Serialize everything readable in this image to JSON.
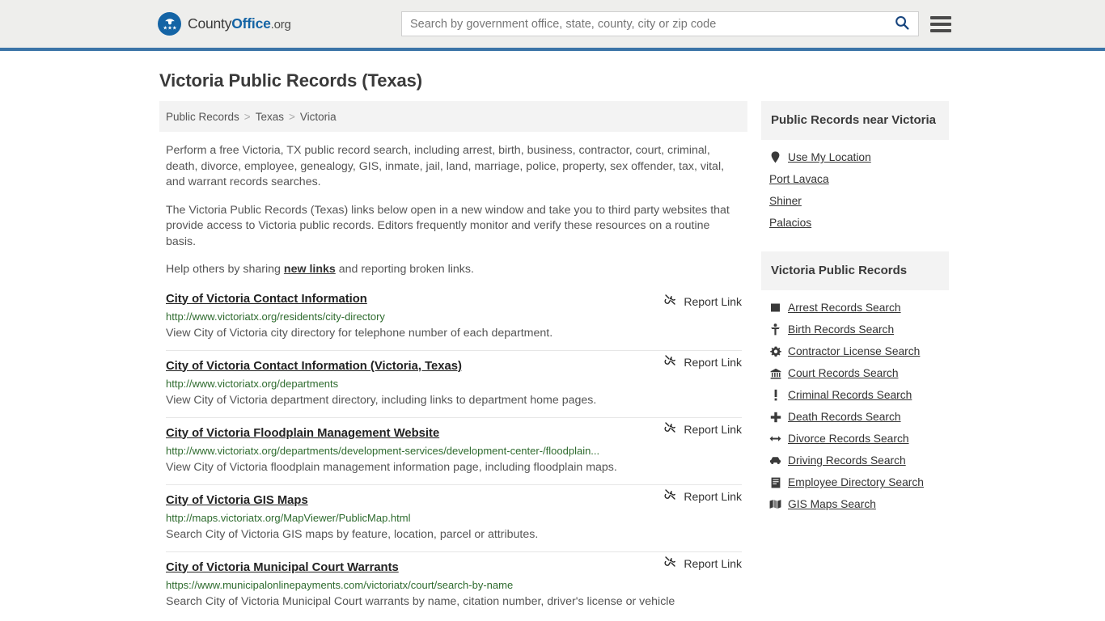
{
  "header": {
    "brand": {
      "county": "County",
      "office": "Office",
      "org": ".org",
      "logo_icon": "eagle-seal-icon"
    },
    "search": {
      "placeholder": "Search by government office, state, county, city or zip code",
      "value": "",
      "search_icon": "search-icon"
    },
    "menu_icon": "hamburger-menu-icon",
    "accent_color": "#3b74a7",
    "background_color": "#eeeeec"
  },
  "page": {
    "title": "Victoria Public Records (Texas)"
  },
  "breadcrumb": {
    "items": [
      {
        "label": "Public Records"
      },
      {
        "label": "Texas"
      },
      {
        "label": "Victoria"
      }
    ],
    "separator": ">"
  },
  "intro": {
    "paragraph1": "Perform a free Victoria, TX public record search, including arrest, birth, business, contractor, court, criminal, death, divorce, employee, genealogy, GIS, inmate, jail, land, marriage, police, property, sex offender, tax, vital, and warrant records searches.",
    "paragraph2": "The Victoria Public Records (Texas) links below open in a new window and take you to third party websites that provide access to Victoria public records. Editors frequently monitor and verify these resources on a routine basis.",
    "paragraph3_prefix": "Help others by sharing ",
    "paragraph3_link": "new links",
    "paragraph3_suffix": " and reporting broken links."
  },
  "report_link": {
    "label": "Report Link",
    "icon": "broken-link-icon"
  },
  "links": [
    {
      "title": "City of Victoria Contact Information",
      "url": "http://www.victoriatx.org/residents/city-directory",
      "description": "View City of Victoria city directory for telephone number of each department."
    },
    {
      "title": "City of Victoria Contact Information (Victoria, Texas)",
      "url": "http://www.victoriatx.org/departments",
      "description": "View City of Victoria department directory, including links to department home pages."
    },
    {
      "title": "City of Victoria Floodplain Management Website",
      "url": "http://www.victoriatx.org/departments/development-services/development-center-/floodplain...",
      "description": "View City of Victoria floodplain management information page, including floodplain maps."
    },
    {
      "title": "City of Victoria GIS Maps",
      "url": "http://maps.victoriatx.org/MapViewer/PublicMap.html",
      "description": "Search City of Victoria GIS maps by feature, location, parcel or attributes."
    },
    {
      "title": "City of Victoria Municipal Court Warrants",
      "url": "https://www.municipalonlinepayments.com/victoriatx/court/search-by-name",
      "description": "Search City of Victoria Municipal Court warrants by name, citation number, driver's license or vehicle"
    }
  ],
  "sidebar": {
    "near_panel": {
      "title": "Public Records near Victoria",
      "items": [
        {
          "label": "Use My Location",
          "icon": "map-pin-icon"
        },
        {
          "label": "Port Lavaca",
          "icon": ""
        },
        {
          "label": "Shiner",
          "icon": ""
        },
        {
          "label": "Palacios",
          "icon": ""
        }
      ]
    },
    "records_panel": {
      "title": "Victoria Public Records",
      "items": [
        {
          "label": "Arrest Records Search",
          "icon": "square-icon",
          "glyph": "■"
        },
        {
          "label": "Birth Records Search",
          "icon": "baby-icon",
          "glyph": "Ɣ"
        },
        {
          "label": "Contractor License Search",
          "icon": "gear-icon",
          "glyph": "⚙"
        },
        {
          "label": "Court Records Search",
          "icon": "courthouse-icon",
          "glyph": "🏛"
        },
        {
          "label": "Criminal Records Search",
          "icon": "exclamation-icon",
          "glyph": "!"
        },
        {
          "label": "Death Records Search",
          "icon": "cross-icon",
          "glyph": "✚"
        },
        {
          "label": "Divorce Records Search",
          "icon": "left-right-arrow-icon",
          "glyph": "↔"
        },
        {
          "label": "Driving Records Search",
          "icon": "car-icon",
          "glyph": "🚗"
        },
        {
          "label": "Employee Directory Search",
          "icon": "book-icon",
          "glyph": "▤"
        },
        {
          "label": "GIS Maps Search",
          "icon": "map-icon",
          "glyph": "🗺"
        }
      ]
    }
  }
}
